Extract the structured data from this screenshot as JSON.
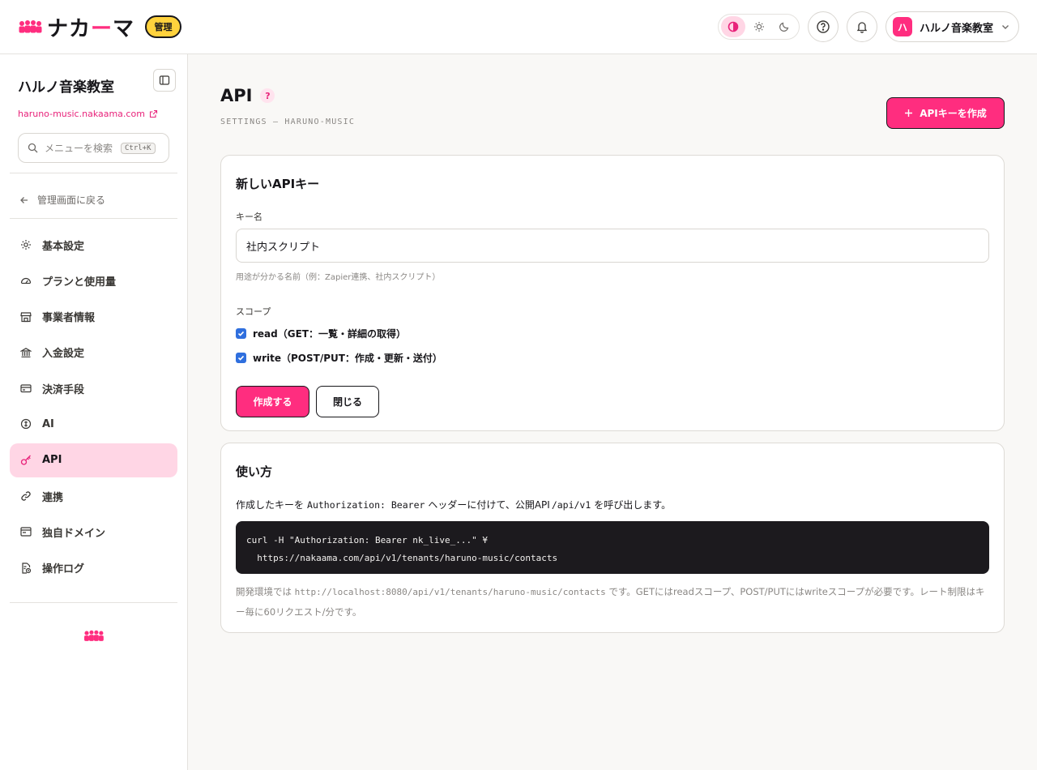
{
  "app": {
    "logo_text_before": "ナカ",
    "logo_text_dash": "ー",
    "logo_text_after": "マ",
    "admin_badge": "管理",
    "brand_color": "#ff2d7f"
  },
  "header": {
    "theme_options": [
      "auto-contrast-icon",
      "sun-icon",
      "moon-icon"
    ],
    "theme_selected": "auto",
    "user": {
      "avatar_initial": "ハ",
      "name": "ハルノ音楽教室"
    }
  },
  "sidebar": {
    "org_name": "ハルノ音楽教室",
    "org_url": "haruno-music.nakaama.com",
    "search_placeholder": "メニューを検索",
    "search_shortcut": "Ctrl+K",
    "back_label": "管理画面に戻る",
    "items": [
      {
        "label": "基本設定",
        "icon": "gear-icon",
        "active": false
      },
      {
        "label": "プランと使用量",
        "icon": "gauge-icon",
        "active": false
      },
      {
        "label": "事業者情報",
        "icon": "store-icon",
        "active": false
      },
      {
        "label": "入金設定",
        "icon": "bank-icon",
        "active": false
      },
      {
        "label": "決済手段",
        "icon": "credit-card-icon",
        "active": false
      },
      {
        "label": "AI",
        "icon": "ai-icon",
        "active": false
      },
      {
        "label": "API",
        "icon": "key-icon",
        "active": true
      },
      {
        "label": "連携",
        "icon": "link-icon",
        "active": false
      },
      {
        "label": "独自ドメイン",
        "icon": "domain-icon",
        "active": false
      },
      {
        "label": "操作ログ",
        "icon": "log-file-icon",
        "active": false
      }
    ]
  },
  "main": {
    "title": "API",
    "subtitle": "SETTINGS — HARUNO-MUSIC",
    "create_key_button": "APIキーを作成",
    "new_key_card": {
      "title": "新しいAPIキー",
      "key_name_label": "キー名",
      "key_name_value": "社内スクリプト",
      "key_name_hint": "用途が分かる名前（例：Zapier連携、社内スクリプト）",
      "scope_label": "スコープ",
      "scopes": [
        {
          "name": "read",
          "desc": "（GET：一覧・詳細の取得）",
          "checked": true
        },
        {
          "name": "write",
          "desc": "（POST/PUT：作成・更新・送付）",
          "checked": true
        }
      ],
      "submit_button": "作成する",
      "close_button": "閉じる"
    },
    "usage_card": {
      "title": "使い方",
      "desc_1": "作成したキーを",
      "desc_code_1": "Authorization: Bearer",
      "desc_2": "ヘッダーに付けて、公開API",
      "desc_code_2": "/api/v1",
      "desc_3": "を呼び出します。",
      "code_line_1": "curl -H \"Authorization: Bearer nk_live_...\" ¥",
      "code_line_2": "  https://nakaama.com/api/v1/tenants/haruno-music/contacts",
      "note_1": "開発環境では",
      "note_code": "http://localhost:8080/api/v1/tenants/haruno-music/contacts",
      "note_2": "です。GETにはreadスコープ、POST/PUTにはwriteスコープが必要です。レート制限はキー毎に60リクエスト/分です。"
    }
  }
}
